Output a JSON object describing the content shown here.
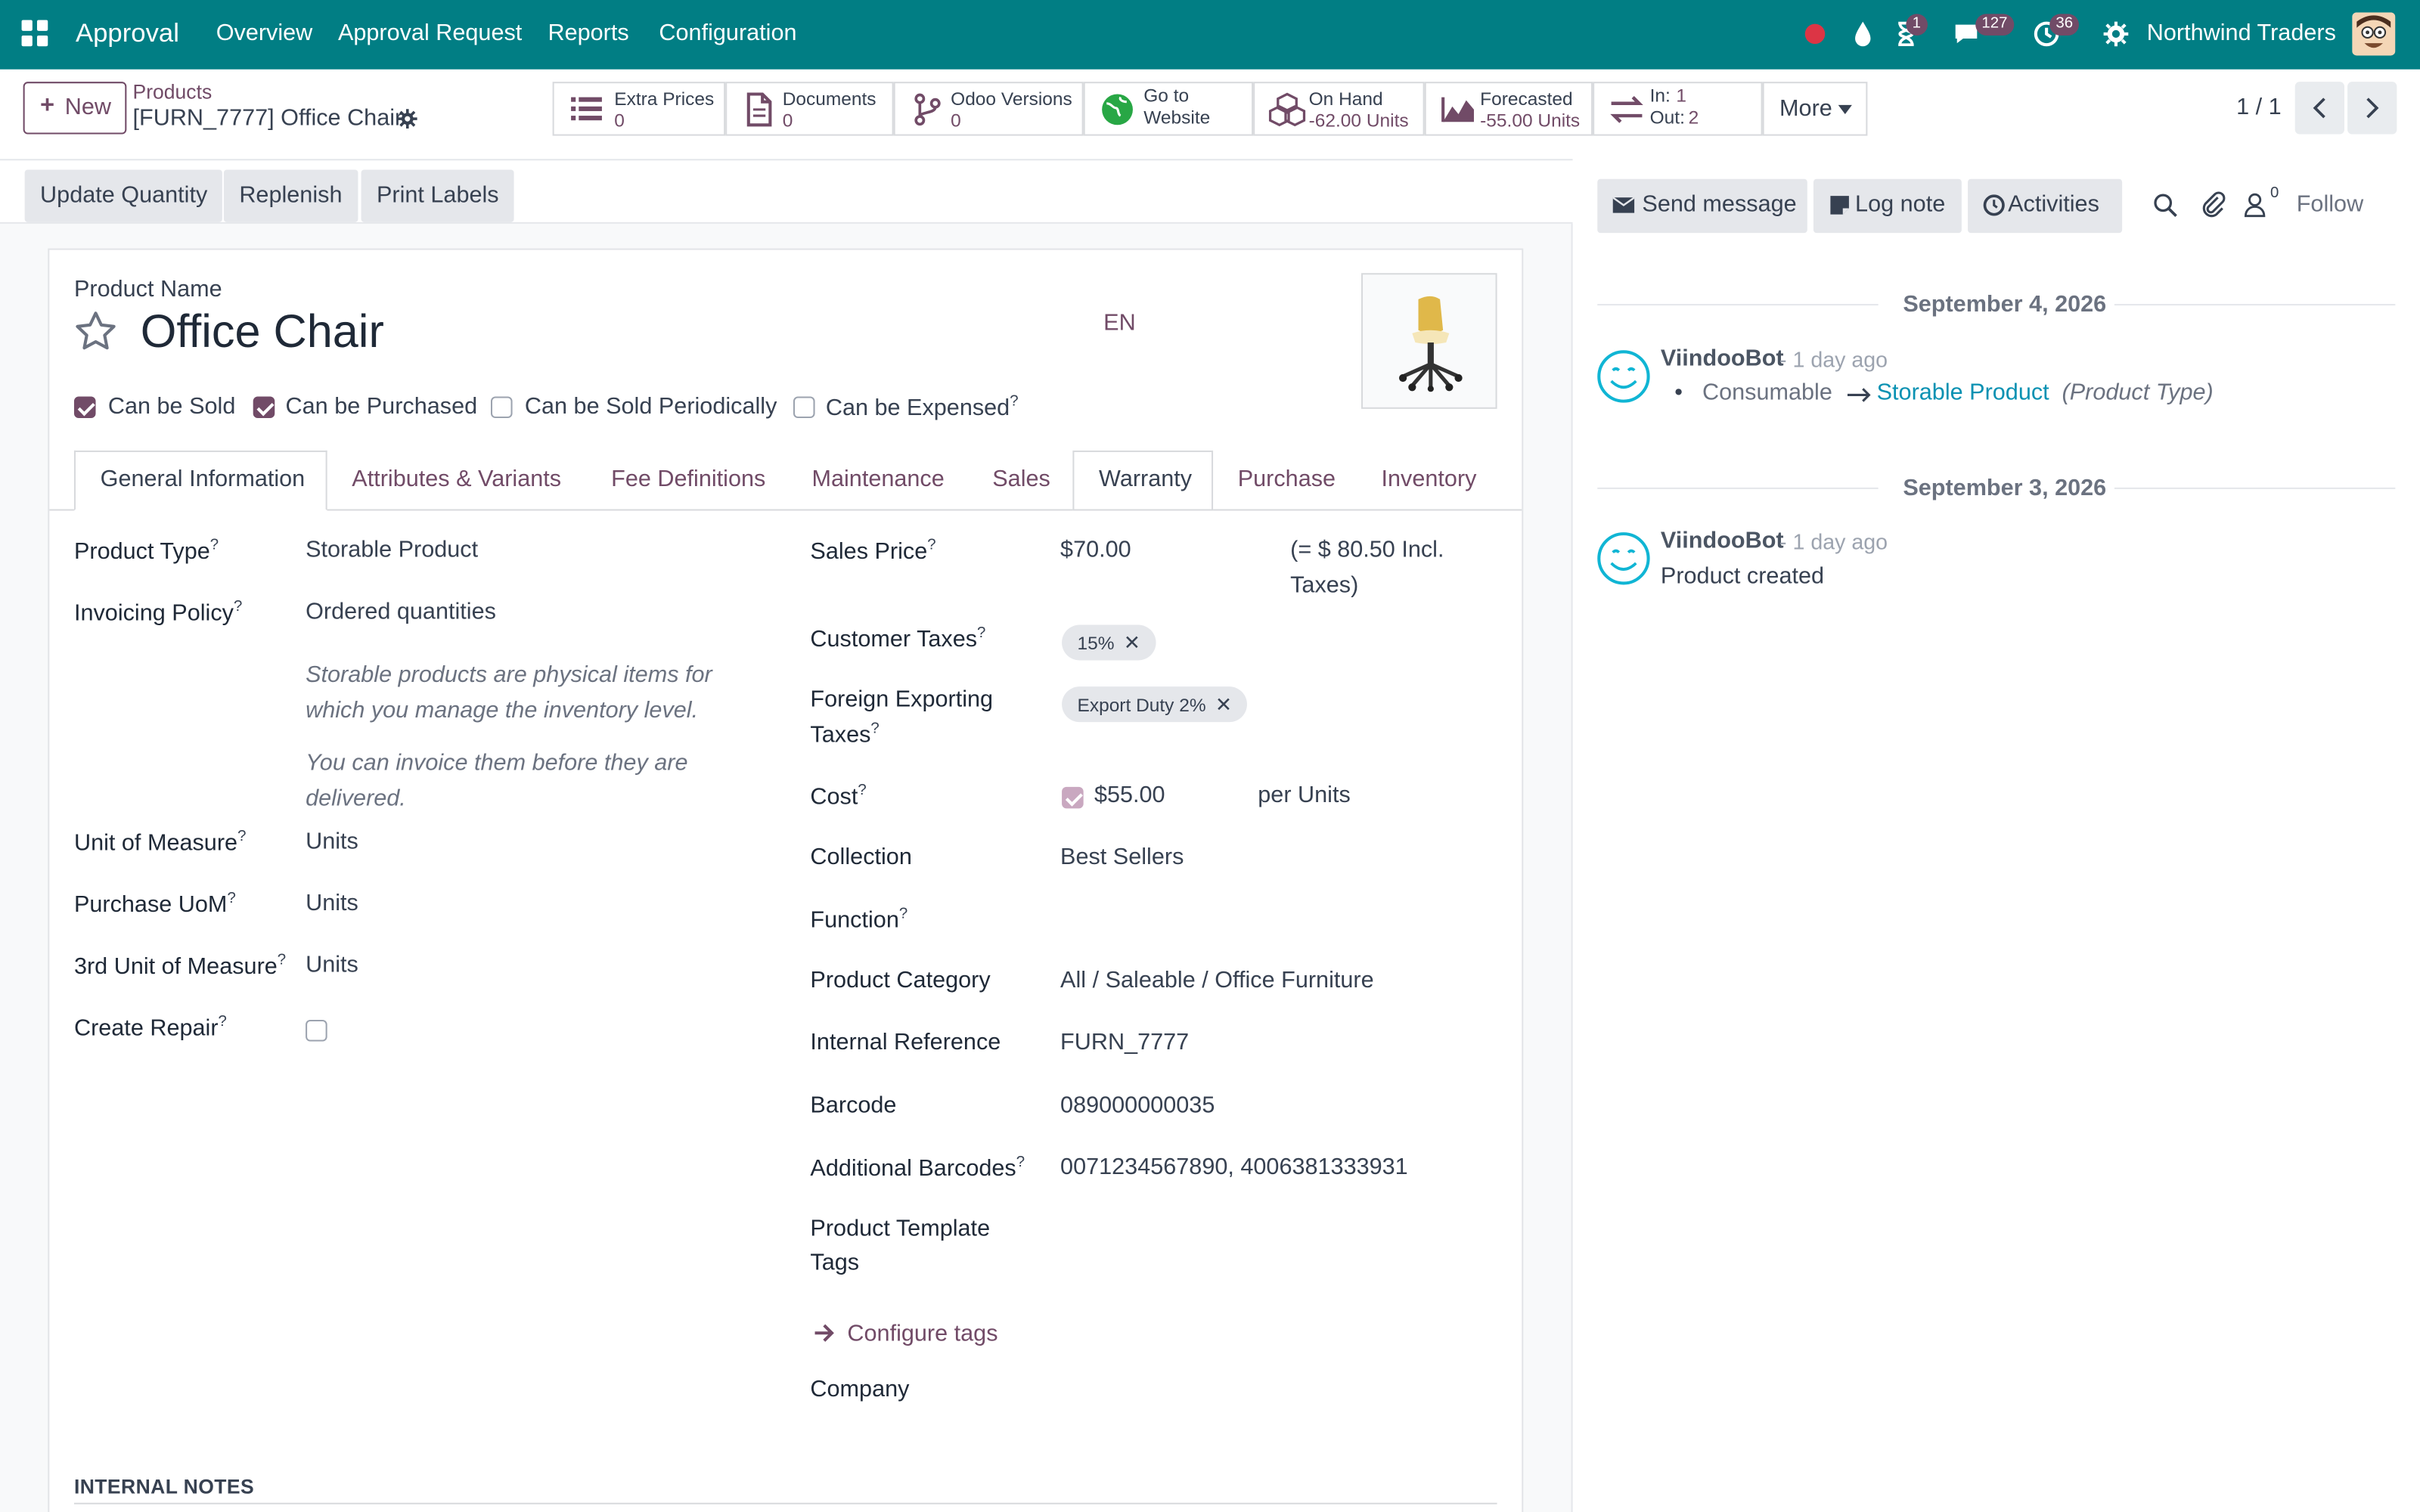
{
  "navbar": {
    "app_name": "Approval",
    "menu": [
      "Overview",
      "Approval Request",
      "Reports",
      "Configuration"
    ],
    "activity_badge": "1",
    "messages_badge": "127",
    "clock_badge": "36",
    "company": "Northwind Traders"
  },
  "control_panel": {
    "new_label": "New",
    "breadcrumb_parent": "Products",
    "breadcrumb_current": "[FURN_7777] Office Chair",
    "smart_buttons": {
      "extra_prices": {
        "label": "Extra Prices",
        "value": "0"
      },
      "documents": {
        "label": "Documents",
        "value": "0"
      },
      "odoo_versions": {
        "label": "Odoo Versions",
        "value": "0"
      },
      "website": {
        "label1": "Go to",
        "label2": "Website"
      },
      "on_hand": {
        "label": "On Hand",
        "value": "-62.00 Units"
      },
      "forecasted": {
        "label": "Forecasted",
        "value": "-55.00 Units"
      },
      "in_out": {
        "in_label": "In:",
        "in_value": "1",
        "out_label": "Out:",
        "out_value": "2"
      },
      "more": "More"
    },
    "pager": "1 / 1"
  },
  "actions": {
    "update_quantity": "Update Quantity",
    "replenish": "Replenish",
    "print_labels": "Print Labels"
  },
  "product": {
    "name_label": "Product Name",
    "name": "Office Chair",
    "lang": "EN",
    "flags": {
      "can_be_sold": "Can be Sold",
      "can_be_purchased": "Can be Purchased",
      "can_be_sold_periodically": "Can be Sold Periodically",
      "can_be_expensed": "Can be Expensed"
    },
    "flag_states": {
      "can_be_sold": true,
      "can_be_purchased": true,
      "can_be_sold_periodically": false,
      "can_be_expensed": false
    }
  },
  "tabs": [
    "General Information",
    "Attributes & Variants",
    "Fee Definitions",
    "Maintenance",
    "Sales",
    "Warranty",
    "Purchase",
    "Inventory"
  ],
  "general": {
    "left": {
      "product_type_label": "Product Type",
      "product_type": "Storable Product",
      "invoicing_policy_label": "Invoicing Policy",
      "invoicing_policy": "Ordered quantities",
      "help_1": "Storable products are physical items for which you manage the inventory level.",
      "help_2": "You can invoice them before they are delivered.",
      "uom_label": "Unit of Measure",
      "uom": "Units",
      "purchase_uom_label": "Purchase UoM",
      "purchase_uom": "Units",
      "third_uom_label": "3rd Unit of Measure",
      "third_uom": "Units",
      "create_repair_label": "Create Repair"
    },
    "right": {
      "sales_price_label": "Sales Price",
      "sales_price": "$70.00",
      "incl_taxes_1": "(= $ 80.50 Incl.",
      "incl_taxes_2": "Taxes)",
      "customer_taxes_label": "Customer Taxes",
      "customer_tax_tag": "15%",
      "foreign_taxes_label_1": "Foreign Exporting",
      "foreign_taxes_label_2": "Taxes",
      "foreign_tax_tag": "Export Duty 2%",
      "cost_label": "Cost",
      "cost": "$55.00",
      "cost_per": "per Units",
      "collection_label": "Collection",
      "collection": "Best Sellers",
      "function_label": "Function",
      "category_label": "Product Category",
      "category": "All / Saleable / Office Furniture",
      "internal_ref_label": "Internal Reference",
      "internal_ref": "FURN_7777",
      "barcode_label": "Barcode",
      "barcode": "089000000035",
      "additional_barcodes_label": "Additional Barcodes",
      "additional_barcodes": "0071234567890, 4006381333931",
      "template_tags_label_1": "Product Template",
      "template_tags_label_2": "Tags",
      "configure_tags": "Configure tags",
      "company_label": "Company"
    },
    "internal_notes": "INTERNAL NOTES"
  },
  "chatter": {
    "send_message": "Send message",
    "log_note": "Log note",
    "activities": "Activities",
    "followers_count": "0",
    "follow": "Follow",
    "messages": [
      {
        "date": "September 4, 2026",
        "author": "ViindooBot",
        "time": "- 1 day ago",
        "old_value": "Consumable",
        "new_value": "Storable Product",
        "field": "(Product Type)"
      },
      {
        "date": "September 3, 2026",
        "author": "ViindooBot",
        "time": "- 1 day ago",
        "body": "Product created"
      }
    ]
  },
  "colors": {
    "navbar": "#017e84",
    "primary": "#714b67",
    "link": "#0891b2"
  }
}
